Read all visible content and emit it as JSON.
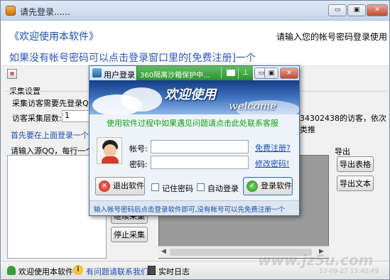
{
  "window": {
    "title": "请先登录......",
    "btn_min": "▭",
    "btn_max": "▣",
    "btn_close": "✕"
  },
  "header": {
    "welcome": "《欢迎使用本软件》",
    "prompt": "请输入您的帐号密码登录使用"
  },
  "notice": "如果没有帐号密码可以点击登录窗口里的[免费注册]一个",
  "settings": {
    "group_label": "采集设置",
    "visitor_label": "采集访客需要先登录QQ:",
    "depth_label": "访客采集层数:",
    "depth_value": "1",
    "visitor_note": "34302438的访客，依次类推",
    "hint": "首先要在上面登录一个QQ",
    "source_label": "请输入源QQ，每行一个QQ号",
    "export_label": "导出",
    "export_table": "导出表格",
    "export_text": "导出文本",
    "continue_btn": "继续采集",
    "stop_btn": "停止采集"
  },
  "statusbar": {
    "welcome": "欢迎使用本软件",
    "help": "有问题请联系我们",
    "log": "实时日志",
    "timestamp": "13-09-27 15:40:49"
  },
  "watermark": "www.jz5u.com",
  "dialog": {
    "title": "用户登录",
    "tab_text": "360隔离沙箱保护中...",
    "banner_cn": "欢迎使用",
    "banner_en": "welcome",
    "service_text": "使用软件过程中如果遇见问题请点击此处联系客服",
    "account_label": "帐号:",
    "password_label": "密码:",
    "account_value": "",
    "password_value": "",
    "register_link": "免费注册?",
    "change_pwd_link": "修改密码!",
    "exit_btn": "退出软件",
    "remember_label": "记住密码",
    "auto_label": "自动登录",
    "login_btn": "登录软件",
    "footer": "输入帐号密码后点击登录软件即可,没有帐号可以先免费注册一个"
  },
  "colors": {
    "link_blue": "#1a4fb0",
    "banner_dark": "#173d86",
    "green_text": "#12a012",
    "notice_blue": "#2a55b8"
  }
}
